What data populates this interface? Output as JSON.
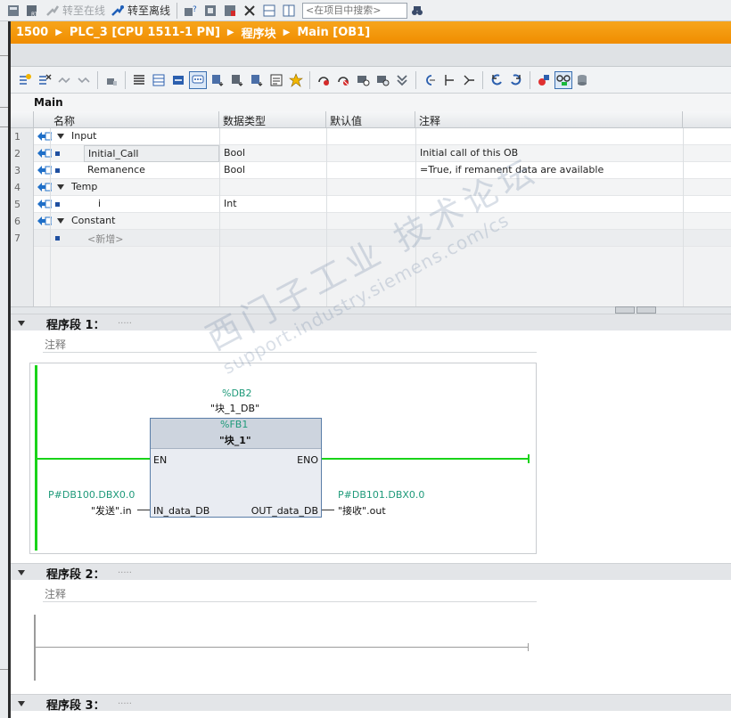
{
  "toolbar": {
    "go_online": "转至在线",
    "go_offline": "转至离线",
    "search_placeholder": "<在项目中搜索>"
  },
  "breadcrumb": [
    "1500",
    "PLC_3 [CPU 1511-1 PN]",
    "程序块",
    "Main [OB1]"
  ],
  "interface": {
    "title": "Main",
    "columns": [
      "名称",
      "数据类型",
      "默认值",
      "注释"
    ],
    "rows": [
      {
        "num": "1",
        "name": "Input",
        "type": "",
        "default": "",
        "comment": ""
      },
      {
        "num": "2",
        "name": "Initial_Call",
        "type": "Bool",
        "default": "",
        "comment": "Initial call of this OB"
      },
      {
        "num": "3",
        "name": "Remanence",
        "type": "Bool",
        "default": "",
        "comment": "=True, if remanent data are available"
      },
      {
        "num": "4",
        "name": "Temp",
        "type": "",
        "default": "",
        "comment": ""
      },
      {
        "num": "5",
        "name": "i",
        "type": "Int",
        "default": "",
        "comment": ""
      },
      {
        "num": "6",
        "name": "Constant",
        "type": "",
        "default": "",
        "comment": ""
      },
      {
        "num": "7",
        "name": "<新增>",
        "type": "",
        "default": "",
        "comment": ""
      }
    ]
  },
  "networks": [
    {
      "title": "程序段 1：",
      "dots": ".....",
      "comment": "注释"
    },
    {
      "title": "程序段 2：",
      "dots": ".....",
      "comment": "注释"
    },
    {
      "title": "程序段 3：",
      "dots": "....."
    }
  ],
  "fb_call": {
    "instance_addr": "%DB2",
    "instance_name": "\"块_1_DB\"",
    "block_addr": "%FB1",
    "block_name": "\"块_1\"",
    "en": "EN",
    "eno": "ENO",
    "in_pin": "IN_data_DB",
    "out_pin": "OUT_data_DB",
    "in_addr": "P#DB100.DBX0.0",
    "in_operand": "\"发送\".in",
    "out_addr": "P#DB101.DBX0.0",
    "out_operand": "\"接收\".out"
  },
  "watermark": {
    "line1": "西门子工业 技术论坛",
    "line2": "support.industry.siemens.com/cs"
  },
  "colors": {
    "accent_orange": "#f08d00",
    "rail_green": "#19d319",
    "address_teal": "#1f9a7a"
  }
}
